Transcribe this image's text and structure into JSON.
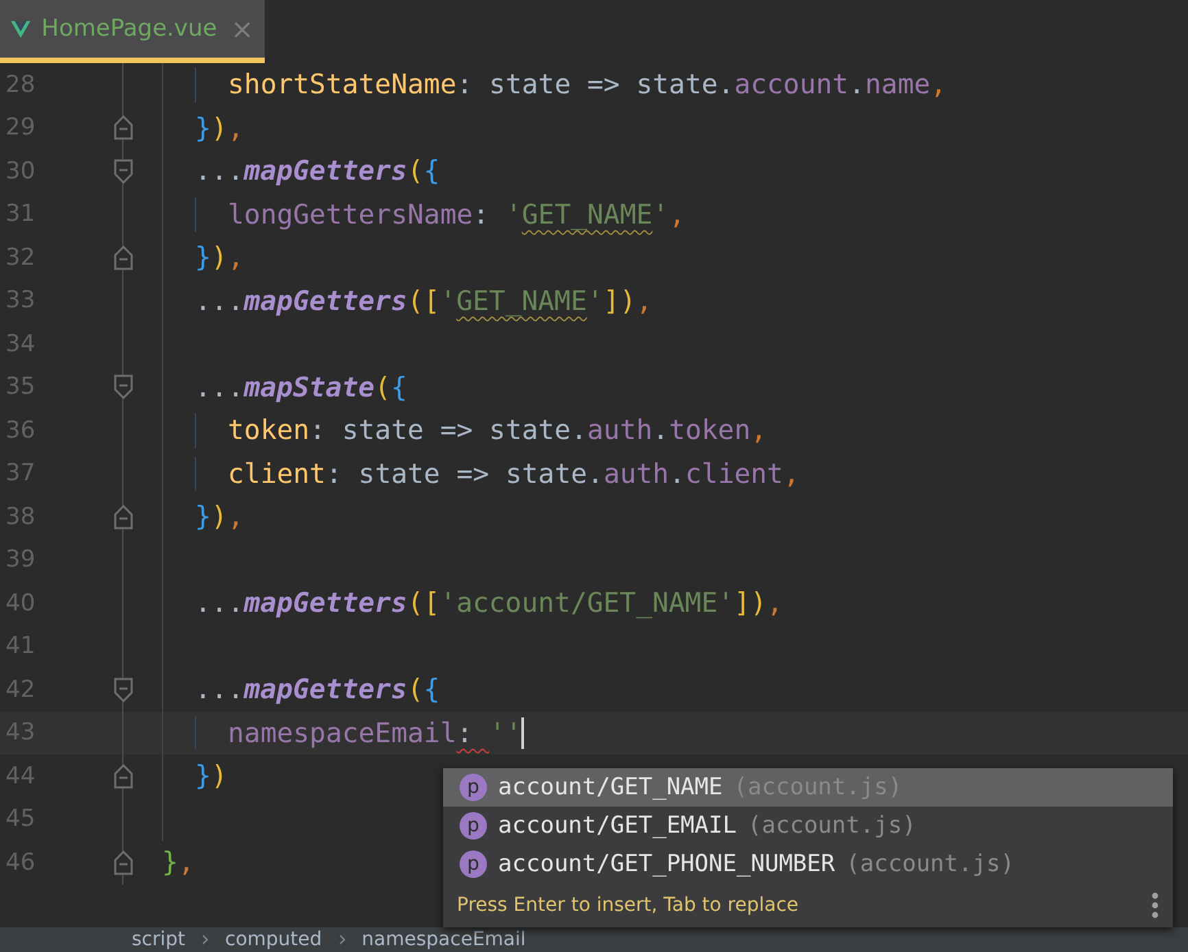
{
  "tab": {
    "title": "HomePage.vue",
    "close": "×",
    "selected": true
  },
  "lines": [
    {
      "number": "46",
      "block_start": false,
      "block_end": true,
      "tokens": [
        {
          "text": "}",
          "kind": "paren2"
        },
        {
          "text": ",",
          "kind": "comma"
        }
      ],
      "children": [
        {
          "children": [
            {
              "number": "28",
              "block_start": false,
              "block_end": false,
              "tokens": [
                {
                  "text": "shortStateName",
                  "kind": "key"
                },
                {
                  "text": ": state => state.",
                  "kind": "plain"
                },
                {
                  "text": "account",
                  "kind": "field"
                },
                {
                  "text": ".",
                  "kind": "plain"
                },
                {
                  "text": "name",
                  "kind": "field"
                },
                {
                  "text": ",",
                  "kind": "comma"
                }
              ]
            }
          ]
        },
        {
          "number": "29",
          "block_start": false,
          "block_end": true,
          "tokens": [
            {
              "text": "}",
              "kind": "brace"
            },
            {
              "text": ")",
              "kind": "paren"
            },
            {
              "text": ",",
              "kind": "comma"
            }
          ]
        },
        {
          "number": "30",
          "block_start": true,
          "block_end": false,
          "tokens": [
            {
              "text": "...",
              "kind": "plain"
            },
            {
              "text": "mapGetters",
              "kind": "method"
            },
            {
              "text": "(",
              "kind": "paren"
            },
            {
              "text": "{",
              "kind": "brace"
            }
          ],
          "children": [
            {
              "number": "31",
              "block_start": false,
              "block_end": false,
              "tokens": [
                {
                  "text": "longGettersName",
                  "kind": "field"
                },
                {
                  "text": ": ",
                  "kind": "plain"
                },
                {
                  "text": "'",
                  "kind": "string"
                },
                {
                  "text": "GET_NAME",
                  "kind": "string",
                  "warning": true
                },
                {
                  "text": "'",
                  "kind": "string"
                },
                {
                  "text": ",",
                  "kind": "comma"
                }
              ]
            }
          ]
        },
        {
          "number": "32",
          "block_start": false,
          "block_end": true,
          "tokens": [
            {
              "text": "}",
              "kind": "brace"
            },
            {
              "text": ")",
              "kind": "paren"
            },
            {
              "text": ",",
              "kind": "comma"
            }
          ]
        },
        {
          "number": "33",
          "block_start": false,
          "block_end": false,
          "tokens": [
            {
              "text": "...",
              "kind": "plain"
            },
            {
              "text": "mapGetters",
              "kind": "method"
            },
            {
              "text": "(",
              "kind": "paren"
            },
            {
              "text": "[",
              "kind": "paren"
            },
            {
              "text": "'",
              "kind": "string"
            },
            {
              "text": "GET_NAME",
              "kind": "string",
              "warning": true
            },
            {
              "text": "'",
              "kind": "string"
            },
            {
              "text": "]",
              "kind": "paren"
            },
            {
              "text": ")",
              "kind": "paren"
            },
            {
              "text": ",",
              "kind": "comma"
            }
          ]
        },
        {
          "number": "34",
          "block_start": false,
          "block_end": false
        },
        {
          "number": "35",
          "block_start": true,
          "block_end": false,
          "tokens": [
            {
              "text": "...",
              "kind": "plain"
            },
            {
              "text": "mapState",
              "kind": "method"
            },
            {
              "text": "(",
              "kind": "paren"
            },
            {
              "text": "{",
              "kind": "brace"
            }
          ],
          "children": [
            {
              "number": "36",
              "block_start": false,
              "block_end": false,
              "tokens": [
                {
                  "text": "token",
                  "kind": "key"
                },
                {
                  "text": ": state => state.",
                  "kind": "plain"
                },
                {
                  "text": "auth",
                  "kind": "field"
                },
                {
                  "text": ".",
                  "kind": "plain"
                },
                {
                  "text": "token",
                  "kind": "field"
                },
                {
                  "text": ",",
                  "kind": "comma"
                }
              ]
            },
            {
              "number": "37",
              "block_start": false,
              "block_end": false,
              "tokens": [
                {
                  "text": "client",
                  "kind": "key"
                },
                {
                  "text": ": state => state.",
                  "kind": "plain"
                },
                {
                  "text": "auth",
                  "kind": "field"
                },
                {
                  "text": ".",
                  "kind": "plain"
                },
                {
                  "text": "client",
                  "kind": "field"
                },
                {
                  "text": ",",
                  "kind": "comma"
                }
              ]
            }
          ]
        },
        {
          "number": "38",
          "block_start": false,
          "block_end": true,
          "tokens": [
            {
              "text": "}",
              "kind": "brace"
            },
            {
              "text": ")",
              "kind": "paren"
            },
            {
              "text": ",",
              "kind": "comma"
            }
          ]
        },
        {
          "number": "39",
          "block_start": false,
          "block_end": false
        },
        {
          "number": "40",
          "block_start": false,
          "block_end": false,
          "tokens": [
            {
              "text": "...",
              "kind": "plain"
            },
            {
              "text": "mapGetters",
              "kind": "method"
            },
            {
              "text": "(",
              "kind": "paren"
            },
            {
              "text": "[",
              "kind": "paren"
            },
            {
              "text": "'account/GET_NAME'",
              "kind": "string"
            },
            {
              "text": "]",
              "kind": "paren"
            },
            {
              "text": ")",
              "kind": "paren"
            },
            {
              "text": ",",
              "kind": "comma"
            }
          ]
        },
        {
          "number": "41",
          "block_start": false,
          "block_end": false
        },
        {
          "number": "42",
          "block_start": true,
          "block_end": false,
          "tokens": [
            {
              "text": "...",
              "kind": "plain"
            },
            {
              "text": "mapGetters",
              "kind": "method"
            },
            {
              "text": "(",
              "kind": "paren"
            },
            {
              "text": "{",
              "kind": "brace"
            }
          ],
          "children": [
            {
              "number": "43",
              "block_start": false,
              "block_end": false,
              "current": true,
              "tokens": [
                {
                  "text": "namespaceEmail",
                  "kind": "field"
                },
                {
                  "text": ": ",
                  "kind": "plain",
                  "warning": true
                },
                {
                  "text": "'",
                  "kind": "string"
                },
                {
                  "text": "'",
                  "kind": "string",
                  "cursor": true
                }
              ]
            }
          ]
        },
        {
          "number": "44",
          "block_start": false,
          "block_end": true,
          "tokens": [
            {
              "text": "}",
              "kind": "brace"
            },
            {
              "text": ")",
              "kind": "paren"
            }
          ]
        },
        {
          "number": "45",
          "block_start": false,
          "block_end": false
        }
      ]
    }
  ],
  "completion": {
    "items": [
      {
        "icon": "p",
        "name": "account/GET_NAME",
        "source": "(account.js)",
        "selected": true
      },
      {
        "icon": "p",
        "name": "account/GET_EMAIL",
        "source": "(account.js)",
        "selected": false
      },
      {
        "icon": "p",
        "name": "account/GET_PHONE_NUMBER",
        "source": "(account.js)",
        "selected": false
      }
    ],
    "hint": "Press Enter to insert, Tab to replace"
  },
  "breadcrumbs": [
    "script",
    "computed",
    "namespaceEmail"
  ]
}
